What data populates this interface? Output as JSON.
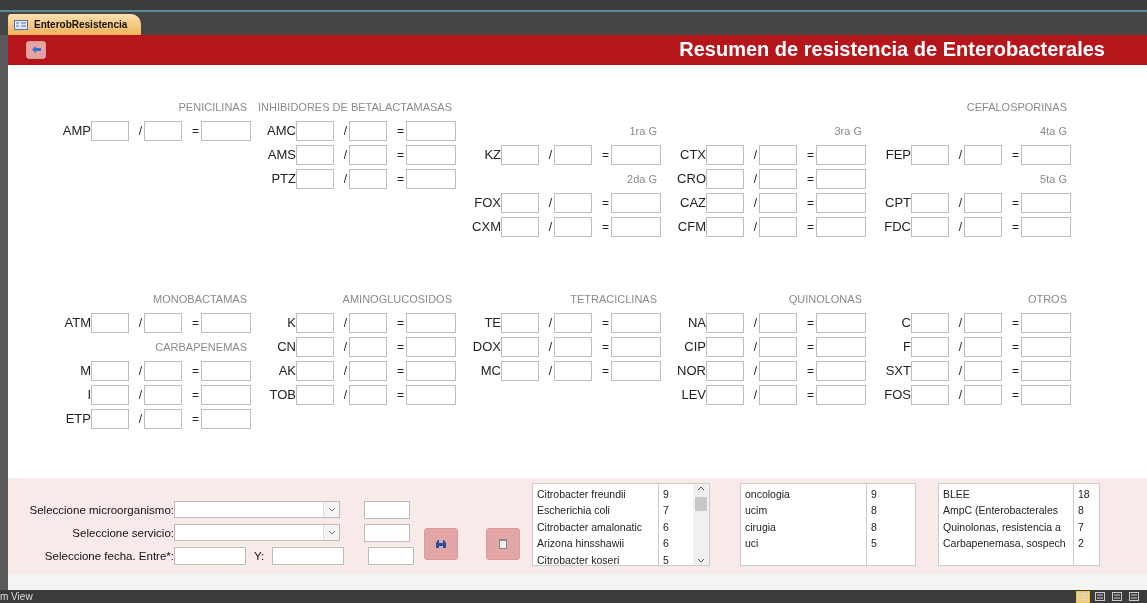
{
  "tab": {
    "title": "EnterobResistencia"
  },
  "header": {
    "title": "Resumen de resistencia de Enterobacterales"
  },
  "sections": [
    {
      "columns": [
        {
          "title": "PENICILINAS",
          "items": [
            {
              "kind": "drug",
              "label": "AMP",
              "slash": "/",
              "equals": "="
            }
          ]
        },
        {
          "title": "INHIBIDORES DE BETALACTAMASAS",
          "items": [
            {
              "kind": "drug",
              "label": "AMC",
              "slash": "/",
              "equals": "="
            },
            {
              "kind": "drug",
              "label": "AMS",
              "slash": "/",
              "equals": "="
            },
            {
              "kind": "drug",
              "label": "PTZ",
              "slash": "/",
              "equals": "="
            }
          ]
        },
        {
          "items": [
            {
              "kind": "subheading",
              "label": "1ra G"
            },
            {
              "kind": "drug",
              "label": "KZ",
              "slash": "/",
              "equals": "="
            },
            {
              "kind": "subheading",
              "label": "2da G"
            },
            {
              "kind": "drug",
              "label": "FOX",
              "slash": "/",
              "equals": "="
            },
            {
              "kind": "drug",
              "label": "CXM",
              "slash": "/",
              "equals": "="
            }
          ]
        },
        {
          "items": [
            {
              "kind": "subheading",
              "label": "3ra G"
            },
            {
              "kind": "drug",
              "label": "CTX",
              "slash": "/",
              "equals": "="
            },
            {
              "kind": "drug",
              "label": "CRO",
              "slash": "/",
              "equals": "="
            },
            {
              "kind": "drug",
              "label": "CAZ",
              "slash": "/",
              "equals": "="
            },
            {
              "kind": "drug",
              "label": "CFM",
              "slash": "/",
              "equals": "="
            }
          ]
        },
        {
          "title": "CEFALOSPORINAS",
          "items": [
            {
              "kind": "subheading",
              "label": "4ta G"
            },
            {
              "kind": "drug",
              "label": "FEP",
              "slash": "/",
              "equals": "="
            },
            {
              "kind": "subheading",
              "label": "5ta G"
            },
            {
              "kind": "drug",
              "label": "CPT",
              "slash": "/",
              "equals": "="
            },
            {
              "kind": "drug",
              "label": "FDC",
              "slash": "/",
              "equals": "="
            }
          ]
        }
      ]
    },
    {
      "columns": [
        {
          "title": "MONOBACTAMAS",
          "items": [
            {
              "kind": "drug",
              "label": "ATM",
              "slash": "/",
              "equals": "="
            },
            {
              "kind": "heading",
              "label": "CARBAPENEMAS"
            },
            {
              "kind": "drug",
              "label": "M",
              "slash": "/",
              "equals": "="
            },
            {
              "kind": "drug",
              "label": "I",
              "slash": "/",
              "equals": "="
            },
            {
              "kind": "drug",
              "label": "ETP",
              "slash": "/",
              "equals": "="
            }
          ]
        },
        {
          "title": "AMINOGLUCOSIDOS",
          "items": [
            {
              "kind": "drug",
              "label": "K",
              "slash": "/",
              "equals": "="
            },
            {
              "kind": "drug",
              "label": "CN",
              "slash": "/",
              "equals": "="
            },
            {
              "kind": "drug",
              "label": "AK",
              "slash": "/",
              "equals": "="
            },
            {
              "kind": "drug",
              "label": "TOB",
              "slash": "/",
              "equals": "="
            }
          ]
        },
        {
          "title": "TETRACICLINAS",
          "items": [
            {
              "kind": "drug",
              "label": "TE",
              "slash": "/",
              "equals": "="
            },
            {
              "kind": "drug",
              "label": "DOX",
              "slash": "/",
              "equals": "="
            },
            {
              "kind": "drug",
              "label": "MC",
              "slash": "/",
              "equals": "="
            }
          ]
        },
        {
          "title": "QUINOLONAS",
          "items": [
            {
              "kind": "drug",
              "label": "NA",
              "slash": "/",
              "equals": "="
            },
            {
              "kind": "drug",
              "label": "CIP",
              "slash": "/",
              "equals": "="
            },
            {
              "kind": "drug",
              "label": "NOR",
              "slash": "/",
              "equals": "="
            },
            {
              "kind": "drug",
              "label": "LEV",
              "slash": "/",
              "equals": "="
            }
          ]
        },
        {
          "title": "OTROS",
          "items": [
            {
              "kind": "drug",
              "label": "C",
              "slash": "/",
              "equals": "="
            },
            {
              "kind": "drug",
              "label": "F",
              "slash": "/",
              "equals": "="
            },
            {
              "kind": "drug",
              "label": "SXT",
              "slash": "/",
              "equals": "="
            },
            {
              "kind": "drug",
              "label": "FOS",
              "slash": "/",
              "equals": "="
            }
          ]
        }
      ]
    }
  ],
  "filters": [
    {
      "kind": "combo",
      "label": "Seleccione microorganismo:"
    },
    {
      "kind": "combo",
      "label": "Seleccione servicio:"
    },
    {
      "kind": "daterange",
      "label": "Seleccione fecha. Entre*:",
      "second_label": "Y:"
    }
  ],
  "lists": [
    {
      "kind": "scrolling",
      "rows": [
        {
          "name": "Citrobacter freundii",
          "count": "9"
        },
        {
          "name": "Escherichia coli",
          "count": "7"
        },
        {
          "name": "Citrobacter amalonatic",
          "count": "6"
        },
        {
          "name": "Arizona hinsshawii",
          "count": "6"
        },
        {
          "name": "Citrobacter koseri",
          "count": "5"
        }
      ]
    },
    {
      "kind": "plain",
      "rows": [
        {
          "name": "oncologia",
          "count": "9"
        },
        {
          "name": "ucim",
          "count": "8"
        },
        {
          "name": "cirugia",
          "count": "8"
        },
        {
          "name": "uci",
          "count": "5"
        }
      ]
    },
    {
      "kind": "plain",
      "rows": [
        {
          "name": "BLEE",
          "count": "18"
        },
        {
          "name": "AmpC (Enterobacterales",
          "count": "8"
        },
        {
          "name": "Quinolonas, resistencia a",
          "count": "7"
        },
        {
          "name": "Carbapenemasa, sospech",
          "count": "2"
        }
      ]
    }
  ],
  "status_bar": {
    "text": "m View",
    "view_buttons": [
      {
        "selected": true
      },
      {
        "selected": false
      },
      {
        "selected": false
      },
      {
        "selected": false
      }
    ]
  }
}
